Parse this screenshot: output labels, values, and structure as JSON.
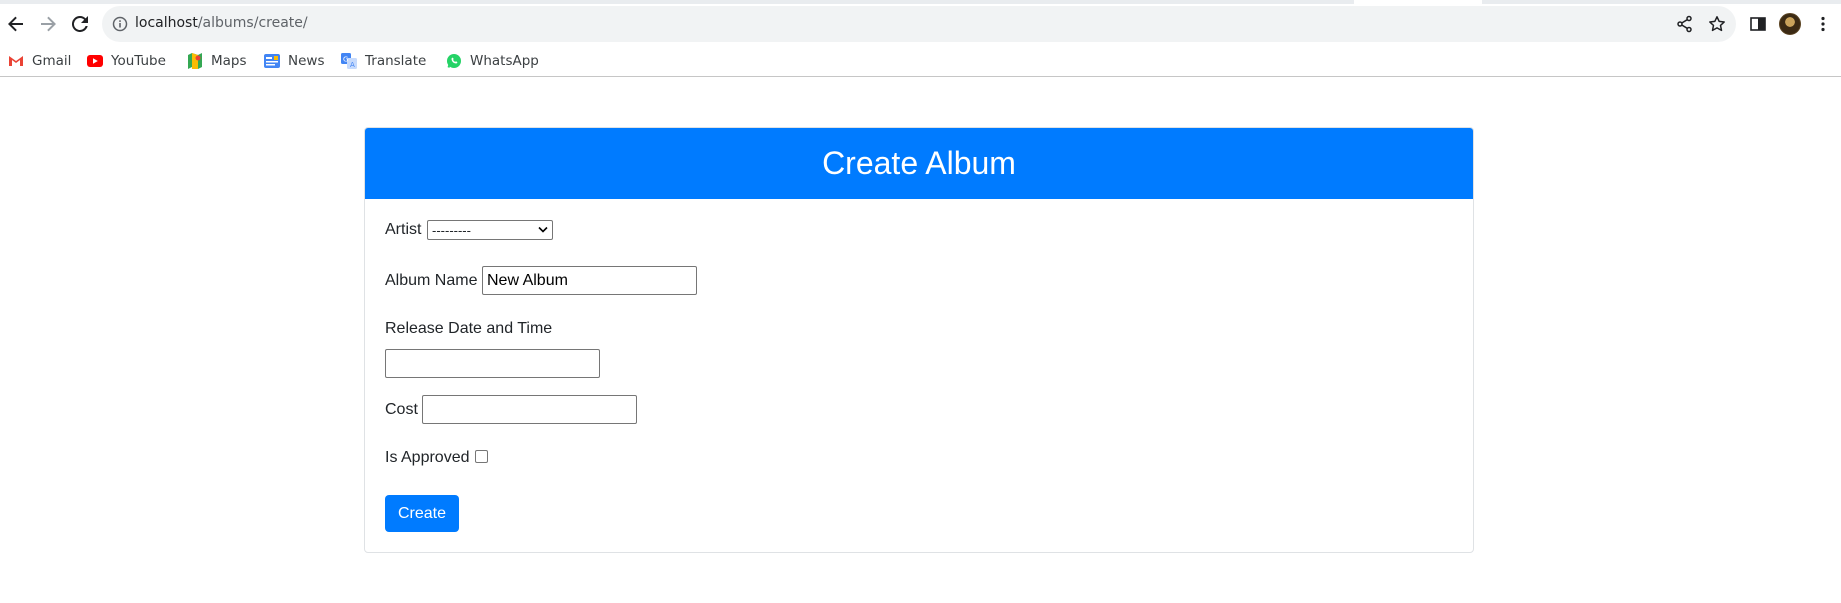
{
  "browser": {
    "url_host": "localhost",
    "url_path": "/albums/create/",
    "bookmarks": [
      {
        "label": "Gmail",
        "icon": "gmail-icon"
      },
      {
        "label": "YouTube",
        "icon": "youtube-icon"
      },
      {
        "label": "Maps",
        "icon": "maps-icon"
      },
      {
        "label": "News",
        "icon": "news-icon"
      },
      {
        "label": "Translate",
        "icon": "translate-icon"
      },
      {
        "label": "WhatsApp",
        "icon": "whatsapp-icon"
      }
    ]
  },
  "form": {
    "title": "Create Album",
    "artist_label": "Artist",
    "artist_selected": "---------",
    "album_name_label": "Album Name",
    "album_name_value": "New Album",
    "release_label": "Release Date and Time",
    "release_value": "",
    "cost_label": "Cost",
    "cost_value": "",
    "approved_label": "Is Approved",
    "approved_checked": false,
    "submit_label": "Create"
  },
  "colors": {
    "primary": "#007bff",
    "card_border": "#dfe2e5",
    "text": "#212529"
  }
}
